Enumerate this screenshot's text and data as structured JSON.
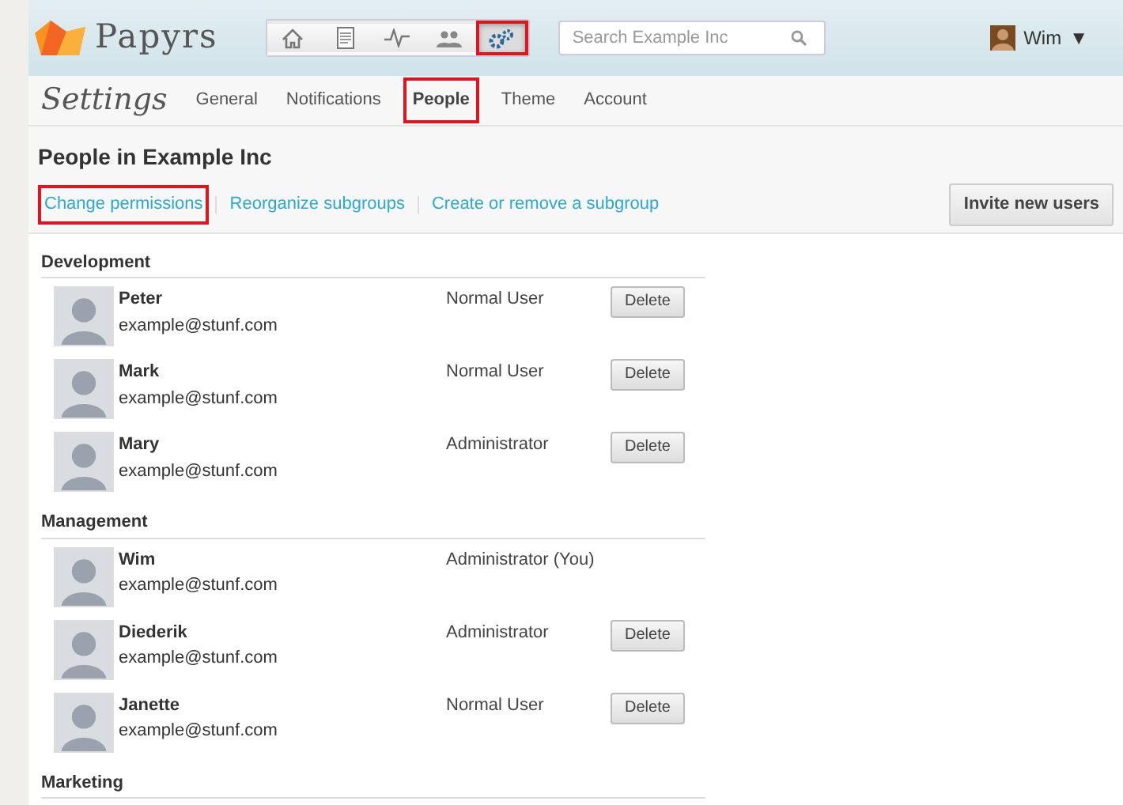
{
  "header": {
    "brand": "Papyrs",
    "nav_icons": [
      {
        "kind": "home",
        "selected": false,
        "highlighted": false
      },
      {
        "kind": "document",
        "selected": false,
        "highlighted": false
      },
      {
        "kind": "activity",
        "selected": false,
        "highlighted": false
      },
      {
        "kind": "people",
        "selected": false,
        "highlighted": false
      },
      {
        "kind": "gears",
        "selected": true,
        "highlighted": true
      }
    ],
    "search": {
      "placeholder": "Search Example Inc"
    },
    "user": {
      "name": "Wim",
      "caret": "▼"
    }
  },
  "settings": {
    "title": "Settings",
    "tabs": [
      {
        "label": "General",
        "selected": false,
        "highlighted": false
      },
      {
        "label": "Notifications",
        "selected": false,
        "highlighted": false
      },
      {
        "label": "People",
        "selected": true,
        "highlighted": true
      },
      {
        "label": "Theme",
        "selected": false,
        "highlighted": false
      },
      {
        "label": "Account",
        "selected": false,
        "highlighted": false
      }
    ]
  },
  "page": {
    "heading": "People in Example Inc",
    "links": [
      {
        "label": "Change permissions",
        "highlighted": true
      },
      {
        "label": "Reorganize subgroups",
        "highlighted": false
      },
      {
        "label": "Create or remove a subgroup",
        "highlighted": false
      }
    ],
    "invite_button": "Invite new users"
  },
  "groups": [
    {
      "name": "Development",
      "members": [
        {
          "name": "Peter",
          "email": "example@stunf.com",
          "role": "Normal User",
          "action": "Delete"
        },
        {
          "name": "Mark",
          "email": "example@stunf.com",
          "role": "Normal User",
          "action": "Delete"
        },
        {
          "name": "Mary",
          "email": "example@stunf.com",
          "role": "Administrator",
          "action": "Delete"
        }
      ]
    },
    {
      "name": "Management",
      "members": [
        {
          "name": "Wim",
          "email": "example@stunf.com",
          "role": "Administrator (You)"
        },
        {
          "name": "Diederik",
          "email": "example@stunf.com",
          "role": "Administrator",
          "action": "Delete"
        },
        {
          "name": "Janette",
          "email": "example@stunf.com",
          "role": "Normal User",
          "action": "Delete"
        }
      ]
    },
    {
      "name": "Marketing"
    }
  ]
}
